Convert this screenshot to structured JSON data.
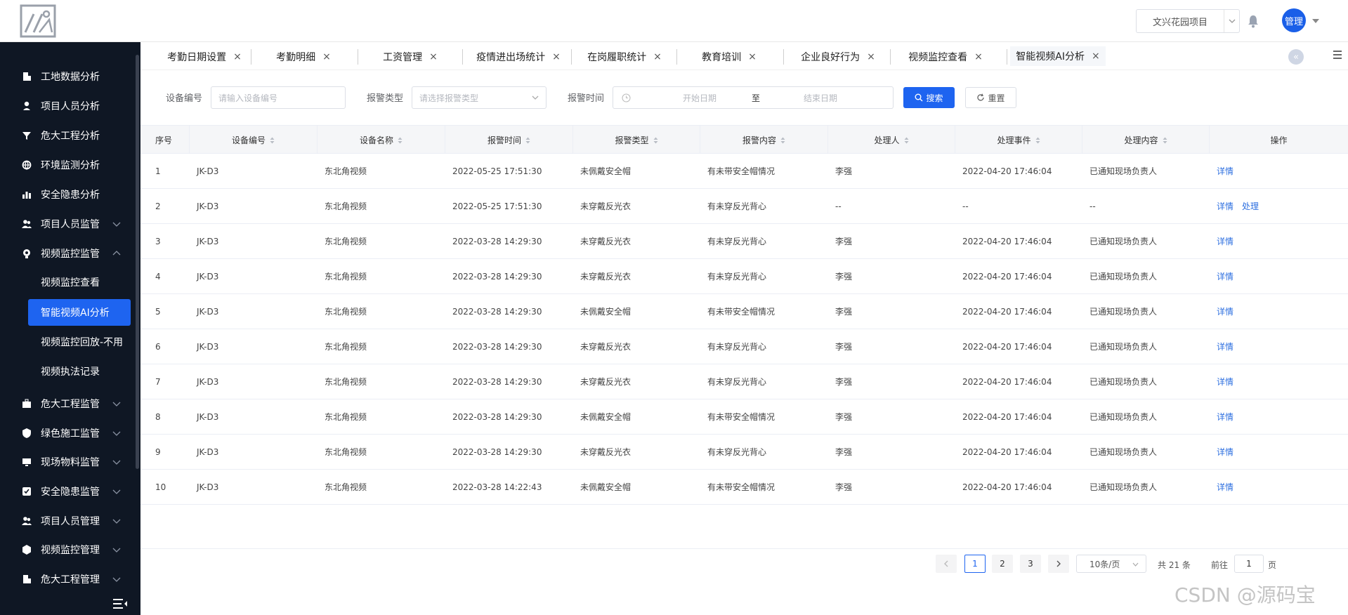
{
  "header": {
    "project_name": "文兴花园项目",
    "avatar_text": "管理"
  },
  "sidebar": {
    "items": [
      {
        "label": "工地数据分析",
        "icon": "building-icon",
        "chevron": null
      },
      {
        "label": "项目人员分析",
        "icon": "person-icon",
        "chevron": null
      },
      {
        "label": "危大工程分析",
        "icon": "funnel-icon",
        "chevron": null
      },
      {
        "label": "环境监测分析",
        "icon": "globe-icon",
        "chevron": null
      },
      {
        "label": "安全隐患分析",
        "icon": "bar-chart-icon",
        "chevron": null
      },
      {
        "label": "项目人员监管",
        "icon": "people-icon",
        "chevron": "down"
      },
      {
        "label": "视频监控监管",
        "icon": "camera-icon",
        "chevron": "up"
      }
    ],
    "sub_items": [
      "视频监控查看",
      "智能视频AI分析",
      "视频监控回放-不用",
      "视频执法记录"
    ],
    "lower_items": [
      {
        "label": "危大工程监管",
        "icon": "briefcase-icon"
      },
      {
        "label": "绿色施工监管",
        "icon": "shield-icon"
      },
      {
        "label": "现场物料监管",
        "icon": "monitor-icon"
      },
      {
        "label": "安全隐患监管",
        "icon": "safety-icon"
      },
      {
        "label": "项目人员管理",
        "icon": "people-icon"
      },
      {
        "label": "视频监控管理",
        "icon": "cube-icon"
      },
      {
        "label": "危大工程管理",
        "icon": "building-icon"
      }
    ]
  },
  "tabs": [
    "考勤日期设置",
    "考勤明细",
    "工资管理",
    "疫情进出场统计",
    "在岗履职统计",
    "教育培训",
    "企业良好行为",
    "视频监控查看",
    "智能视频AI分析"
  ],
  "filters": {
    "device_label": "设备编号",
    "device_placeholder": "请输入设备编号",
    "type_label": "报警类型",
    "type_placeholder": "请选择报警类型",
    "time_label": "报警时间",
    "start_placeholder": "开始日期",
    "range_sep": "至",
    "end_placeholder": "结束日期",
    "search_label": "搜索",
    "reset_label": "重置"
  },
  "table": {
    "headers": [
      "序号",
      "设备编号",
      "设备名称",
      "报警时间",
      "报警类型",
      "报警内容",
      "处理人",
      "处理事件",
      "处理内容",
      "操作"
    ],
    "rows": [
      [
        "1",
        "JK-D3",
        "东北角视频",
        "2022-05-25 17:51:30",
        "未佩戴安全帽",
        "有未带安全帽情况",
        "李强",
        "2022-04-20 17:46:04",
        "已通知现场负责人",
        [
          "详情"
        ]
      ],
      [
        "2",
        "JK-D3",
        "东北角视频",
        "2022-05-25 17:51:30",
        "未穿戴反光衣",
        "有未穿反光背心",
        "--",
        "--",
        "--",
        [
          "详情",
          "处理"
        ]
      ],
      [
        "3",
        "JK-D3",
        "东北角视频",
        "2022-03-28 14:29:30",
        "未穿戴反光衣",
        "有未穿反光背心",
        "李强",
        "2022-04-20 17:46:04",
        "已通知现场负责人",
        [
          "详情"
        ]
      ],
      [
        "4",
        "JK-D3",
        "东北角视频",
        "2022-03-28 14:29:30",
        "未穿戴反光衣",
        "有未穿反光背心",
        "李强",
        "2022-04-20 17:46:04",
        "已通知现场负责人",
        [
          "详情"
        ]
      ],
      [
        "5",
        "JK-D3",
        "东北角视频",
        "2022-03-28 14:29:30",
        "未佩戴安全帽",
        "有未带安全帽情况",
        "李强",
        "2022-04-20 17:46:04",
        "已通知现场负责人",
        [
          "详情"
        ]
      ],
      [
        "6",
        "JK-D3",
        "东北角视频",
        "2022-03-28 14:29:30",
        "未穿戴反光衣",
        "有未穿反光背心",
        "李强",
        "2022-04-20 17:46:04",
        "已通知现场负责人",
        [
          "详情"
        ]
      ],
      [
        "7",
        "JK-D3",
        "东北角视频",
        "2022-03-28 14:29:30",
        "未穿戴反光衣",
        "有未穿反光背心",
        "李强",
        "2022-04-20 17:46:04",
        "已通知现场负责人",
        [
          "详情"
        ]
      ],
      [
        "8",
        "JK-D3",
        "东北角视频",
        "2022-03-28 14:29:30",
        "未佩戴安全帽",
        "有未带安全帽情况",
        "李强",
        "2022-04-20 17:46:04",
        "已通知现场负责人",
        [
          "详情"
        ]
      ],
      [
        "9",
        "JK-D3",
        "东北角视频",
        "2022-03-28 14:29:30",
        "未穿戴反光衣",
        "有未穿反光背心",
        "李强",
        "2022-04-20 17:46:04",
        "已通知现场负责人",
        [
          "详情"
        ]
      ],
      [
        "10",
        "JK-D3",
        "东北角视频",
        "2022-03-28 14:22:43",
        "未佩戴安全帽",
        "有未带安全帽情况",
        "李强",
        "2022-04-20 17:46:04",
        "已通知现场负责人",
        [
          "详情"
        ]
      ]
    ]
  },
  "pagination": {
    "pages": [
      "1",
      "2",
      "3"
    ],
    "current": "1",
    "page_size": "10条/页",
    "total": "共 21 条",
    "goto_prefix": "前往",
    "goto_value": "1",
    "goto_suffix": "页"
  },
  "watermark": "CSDN @源码宝",
  "colors": {
    "sidebar_bg": "#0f1724",
    "accent": "#1e64f0",
    "link": "#2d6fe0"
  }
}
